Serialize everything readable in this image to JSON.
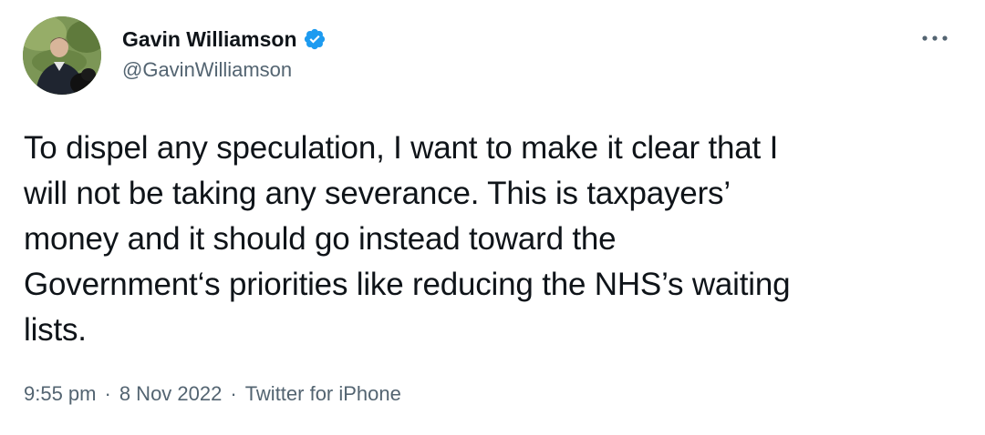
{
  "tweet": {
    "author": {
      "display_name": "Gavin Williamson",
      "handle": "@GavinWilliamson",
      "verified": true
    },
    "text": "To dispel any speculation, I want to make it clear that I\nwill not be taking any severance. This is taxpayers’\nmoney and it should go instead toward the\nGovernment‘s priorities like reducing the NHS’s waiting\nlists.",
    "time": "9:55 pm",
    "date": "8 Nov 2022",
    "source": "Twitter for iPhone",
    "separator": "·"
  },
  "icons": {
    "verified": "verified-badge-icon",
    "more": "more-options-icon"
  },
  "colors": {
    "text_primary": "#0f1419",
    "text_secondary": "#536471",
    "verified_blue": "#1d9bf0",
    "background": "#ffffff"
  }
}
